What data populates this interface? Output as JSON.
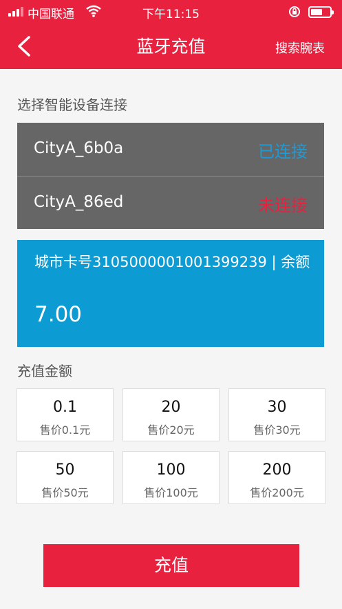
{
  "status_bar": {
    "carrier": "中国联通",
    "time": "下午11:15"
  },
  "header": {
    "title": "蓝牙充值",
    "search_label": "搜索腕表"
  },
  "devices": {
    "section_label": "选择智能设备连接",
    "items": [
      {
        "name": "CityA_6b0a",
        "status": "已连接",
        "status_color": "#1e9ad6"
      },
      {
        "name": "CityA_86ed",
        "status": "未连接",
        "status_color": "#e8213f"
      }
    ]
  },
  "card": {
    "label": "城市卡号3105000001001399239 | 余额",
    "balance": "7.00"
  },
  "amounts": {
    "section_label": "充值金额",
    "options": [
      {
        "value": "0.1",
        "price": "售价0.1元"
      },
      {
        "value": "20",
        "price": "售价20元"
      },
      {
        "value": "30",
        "price": "售价30元"
      },
      {
        "value": "50",
        "price": "售价50元"
      },
      {
        "value": "100",
        "price": "售价100元"
      },
      {
        "value": "200",
        "price": "售价200元"
      }
    ]
  },
  "recharge_button": "充值",
  "colors": {
    "brand_red": "#e8213f",
    "card_blue": "#0c9bd2",
    "device_panel_gray": "#666666"
  }
}
